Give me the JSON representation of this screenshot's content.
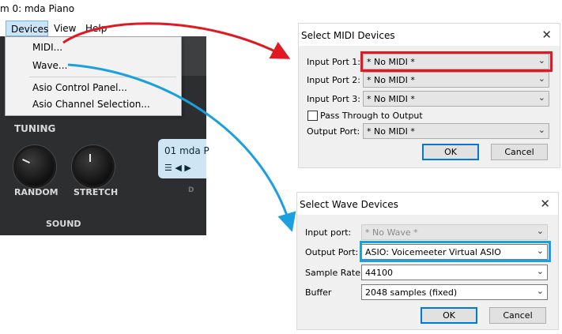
{
  "app": {
    "title": "m 0: mda Piano",
    "menu": [
      "Devices",
      "View",
      "Help"
    ],
    "active_menu": "Devices"
  },
  "devices_menu": {
    "items": [
      "MIDI...",
      "Wave...",
      "Asio Control Panel...",
      "Asio Channel Selection..."
    ]
  },
  "plugin": {
    "tuning_label": "TUNING",
    "random_label": "RANDOM",
    "stretch_label": "STRETCH",
    "sound_label": "SOUND",
    "lcd_text": "01  mda P",
    "lcd_controls": "☰ ◀ ▶",
    "partial_label": "D"
  },
  "midi_dialog": {
    "title": "Select MIDI Devices",
    "fields": [
      {
        "label": "Input Port 1:",
        "value": "* No MIDI *"
      },
      {
        "label": "Input Port 2:",
        "value": "* No MIDI *"
      },
      {
        "label": "Input Port 3:",
        "value": "* No MIDI *"
      }
    ],
    "pass_through_label": "Pass Through to Output",
    "output_label": "Output Port:",
    "output_value": "* No MIDI *",
    "ok": "OK",
    "cancel": "Cancel"
  },
  "wave_dialog": {
    "title": "Select Wave Devices",
    "fields": [
      {
        "label": "Input port:",
        "value": "* No Wave *"
      },
      {
        "label": "Output Port:",
        "value": "ASIO: Voicemeeter Virtual ASIO"
      },
      {
        "label": "Sample Rate:",
        "value": "44100"
      },
      {
        "label": "Buffer",
        "value": "2048 samples (fixed)"
      }
    ],
    "ok": "OK",
    "cancel": "Cancel"
  },
  "colors": {
    "red_arrow": "#e01a22",
    "blue_arrow": "#1aa0de"
  }
}
